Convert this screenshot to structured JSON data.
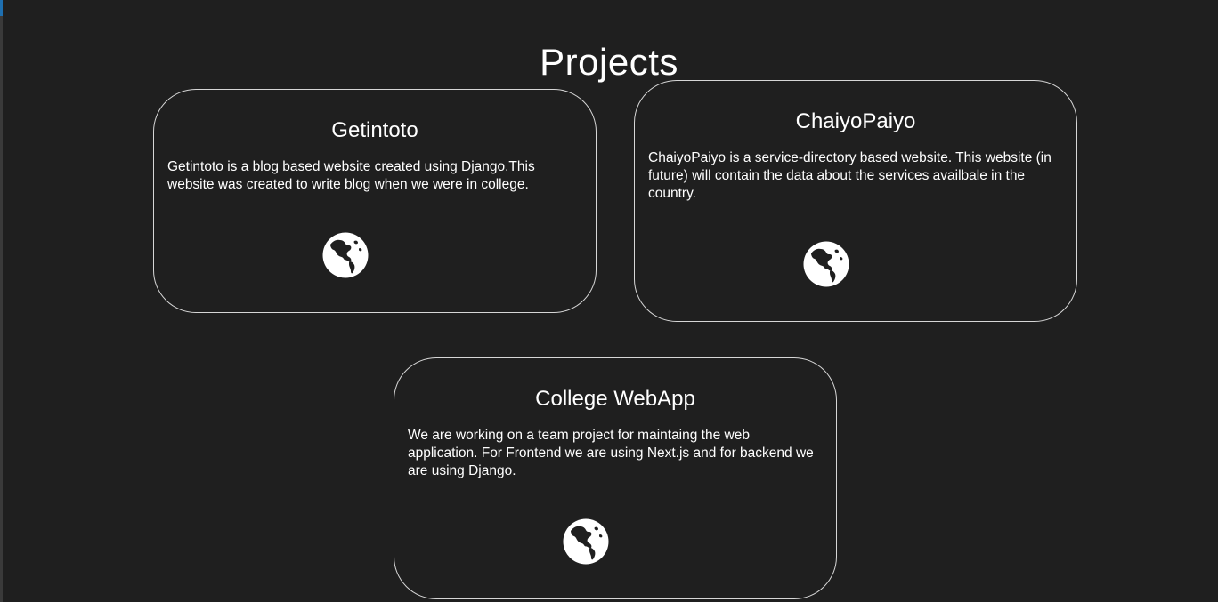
{
  "page": {
    "title": "Projects"
  },
  "projects": [
    {
      "title": "Getintoto",
      "description": "Getintoto is a blog based website created using Django.This website was created to write blog when we were in college.",
      "link_icon": "globe-icon"
    },
    {
      "title": "ChaiyoPaiyo",
      "description": "ChaiyoPaiyo is a service-directory based website. This website (in future) will contain the data about the services availbale in the country.",
      "link_icon": "globe-icon"
    },
    {
      "title": "College WebApp",
      "description": "We are working on a team project for maintaing the web application. For Frontend we are using Next.js and for backend we are using Django.",
      "link_icon": "globe-icon"
    }
  ],
  "colors": {
    "background": "#1f1f1f",
    "text": "#ffffff",
    "card_border": "#d6d6d6",
    "accent": "#1e6fb0"
  }
}
